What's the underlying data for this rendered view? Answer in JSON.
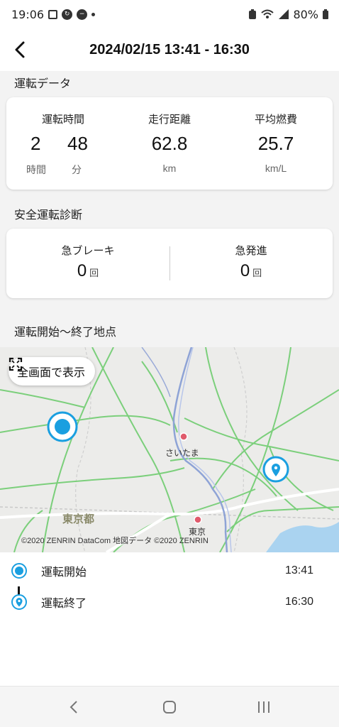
{
  "status_bar": {
    "time": "19:06",
    "battery": "80%",
    "icons": [
      "lens-icon",
      "sync-icon",
      "do-not-disturb-icon",
      "notification-dot-icon",
      "battery-saver-icon",
      "wifi-icon",
      "signal-icon",
      "battery-icon"
    ]
  },
  "header": {
    "title": "2024/02/15 13:41 - 16:30",
    "back_icon": "chevron-left-icon"
  },
  "driving_data": {
    "section_title": "運転データ",
    "duration": {
      "label": "運転時間",
      "hours": "2",
      "minutes": "48",
      "hours_unit": "時間",
      "minutes_unit": "分"
    },
    "distance": {
      "label": "走行距離",
      "value": "62.8",
      "unit": "km"
    },
    "fuel": {
      "label": "平均燃費",
      "value": "25.7",
      "unit": "km/L"
    }
  },
  "safety": {
    "section_title": "安全運転診断",
    "hard_brake": {
      "label": "急ブレーキ",
      "value": "0",
      "unit": "回"
    },
    "hard_start": {
      "label": "急発進",
      "value": "0",
      "unit": "回"
    }
  },
  "map_section": {
    "title": "運転開始〜終了地点",
    "fullscreen_label": "全画面で表示",
    "labels": {
      "saitama": "さいたま",
      "tokyo_to": "東京都",
      "tokyo": "東京"
    },
    "copyright": "©2020 ZENRIN DataCom 地図データ ©2020 ZENRIN"
  },
  "route": {
    "start": {
      "label": "運転開始",
      "time": "13:41"
    },
    "end": {
      "label": "運転終了",
      "time": "16:30"
    }
  },
  "colors": {
    "accent": "#1a9fe0",
    "road_green": "#6fcf6f",
    "road_gray": "#ffffff",
    "water": "#aad3f0",
    "map_bg": "#ececea"
  },
  "nav": [
    "back-nav-icon",
    "home-nav-icon",
    "recents-nav-icon"
  ]
}
